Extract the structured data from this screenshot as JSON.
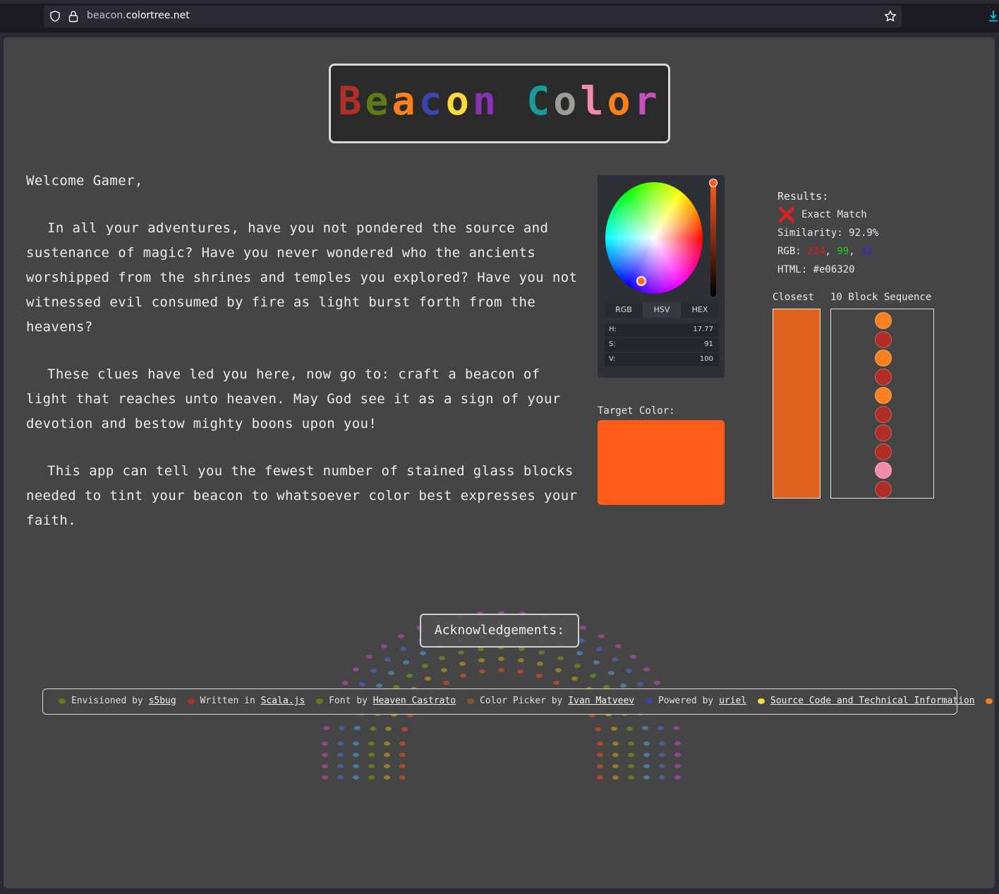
{
  "browser": {
    "url_prefix": "beacon.",
    "url_domain": "colortree.net"
  },
  "logo": {
    "letters": [
      {
        "ch": "B",
        "color": "#b02e26"
      },
      {
        "ch": "e",
        "color": "#5e7c16"
      },
      {
        "ch": "a",
        "color": "#f9801d"
      },
      {
        "ch": "c",
        "color": "#3c44aa"
      },
      {
        "ch": "o",
        "color": "#fed83d"
      },
      {
        "ch": "n",
        "color": "#8932b8"
      },
      {
        "ch": " ",
        "color": "#000000"
      },
      {
        "ch": "C",
        "color": "#169c9c"
      },
      {
        "ch": "o",
        "color": "#9d9d97"
      },
      {
        "ch": "l",
        "color": "#f38baa"
      },
      {
        "ch": "o",
        "color": "#f9801d"
      },
      {
        "ch": "r",
        "color": "#c74ebd"
      }
    ]
  },
  "intro": {
    "greeting": "Welcome Gamer,",
    "p1": "In all your adventures, have you not pondered the source and sustenance of magic?  Have you never wondered who the ancients worshipped from the shrines and temples you explored?  Have you not witnessed evil consumed by fire as light burst forth from the heavens?",
    "p2": "These clues have led you here, now go to: craft a beacon of light that reaches unto heaven. May God see it as a sign of your devotion and bestow mighty boons upon you!",
    "p3": "This app can tell you the fewest number of stained glass blocks needed to tint your beacon to whatsoever color best expresses your faith."
  },
  "picker": {
    "tabs": [
      "RGB",
      "HSV",
      "HEX"
    ],
    "active_tab": "HSV",
    "fields": [
      {
        "label": "H:",
        "value": "17.77"
      },
      {
        "label": "S:",
        "value": "91"
      },
      {
        "label": "V:",
        "value": "100"
      }
    ]
  },
  "target": {
    "label": "Target Color:",
    "color": "#ff5a19"
  },
  "results": {
    "title": "Results:",
    "exact_match_label": "Exact Match",
    "exact_match": false,
    "similarity": "Similarity: 92.9%",
    "rgb_label": "RGB: ",
    "r": "224",
    "g": "99",
    "b": "32",
    "sep": ", ",
    "html": "HTML: #e06320",
    "closest_label": "Closest",
    "sequence_label": "10 Block Sequence",
    "closest_color": "#e06320",
    "sequence": [
      {
        "name": "orange",
        "color": "#f9801d"
      },
      {
        "name": "red",
        "color": "#b02e26"
      },
      {
        "name": "orange",
        "color": "#f9801d"
      },
      {
        "name": "red",
        "color": "#b02e26"
      },
      {
        "name": "orange",
        "color": "#f9801d"
      },
      {
        "name": "red",
        "color": "#b02e26"
      },
      {
        "name": "red",
        "color": "#b02e26"
      },
      {
        "name": "red",
        "color": "#b02e26"
      },
      {
        "name": "pink",
        "color": "#f38baa"
      },
      {
        "name": "red",
        "color": "#b02e26"
      }
    ]
  },
  "acknowledgements": "Acknowledgements:",
  "footer": {
    "envisioned_by": "Envisioned by",
    "s5bug": "s5bug",
    "written_in": "Written in",
    "scalajs": "Scala.js",
    "font_by": "Font by",
    "font_author": "Heaven Castrato",
    "picker_by": "Color Picker by",
    "picker_author": "Ivan Matveev",
    "powered_by": "Powered by",
    "uriel": "uriel",
    "source": "Source Code and Technical Information"
  },
  "colors": {
    "page_bg": "#454545",
    "chrome_bg": "#1c1b22",
    "red_value": "#e01b1b",
    "green_value": "#1bd11b",
    "blue_value": "#2424e0"
  }
}
